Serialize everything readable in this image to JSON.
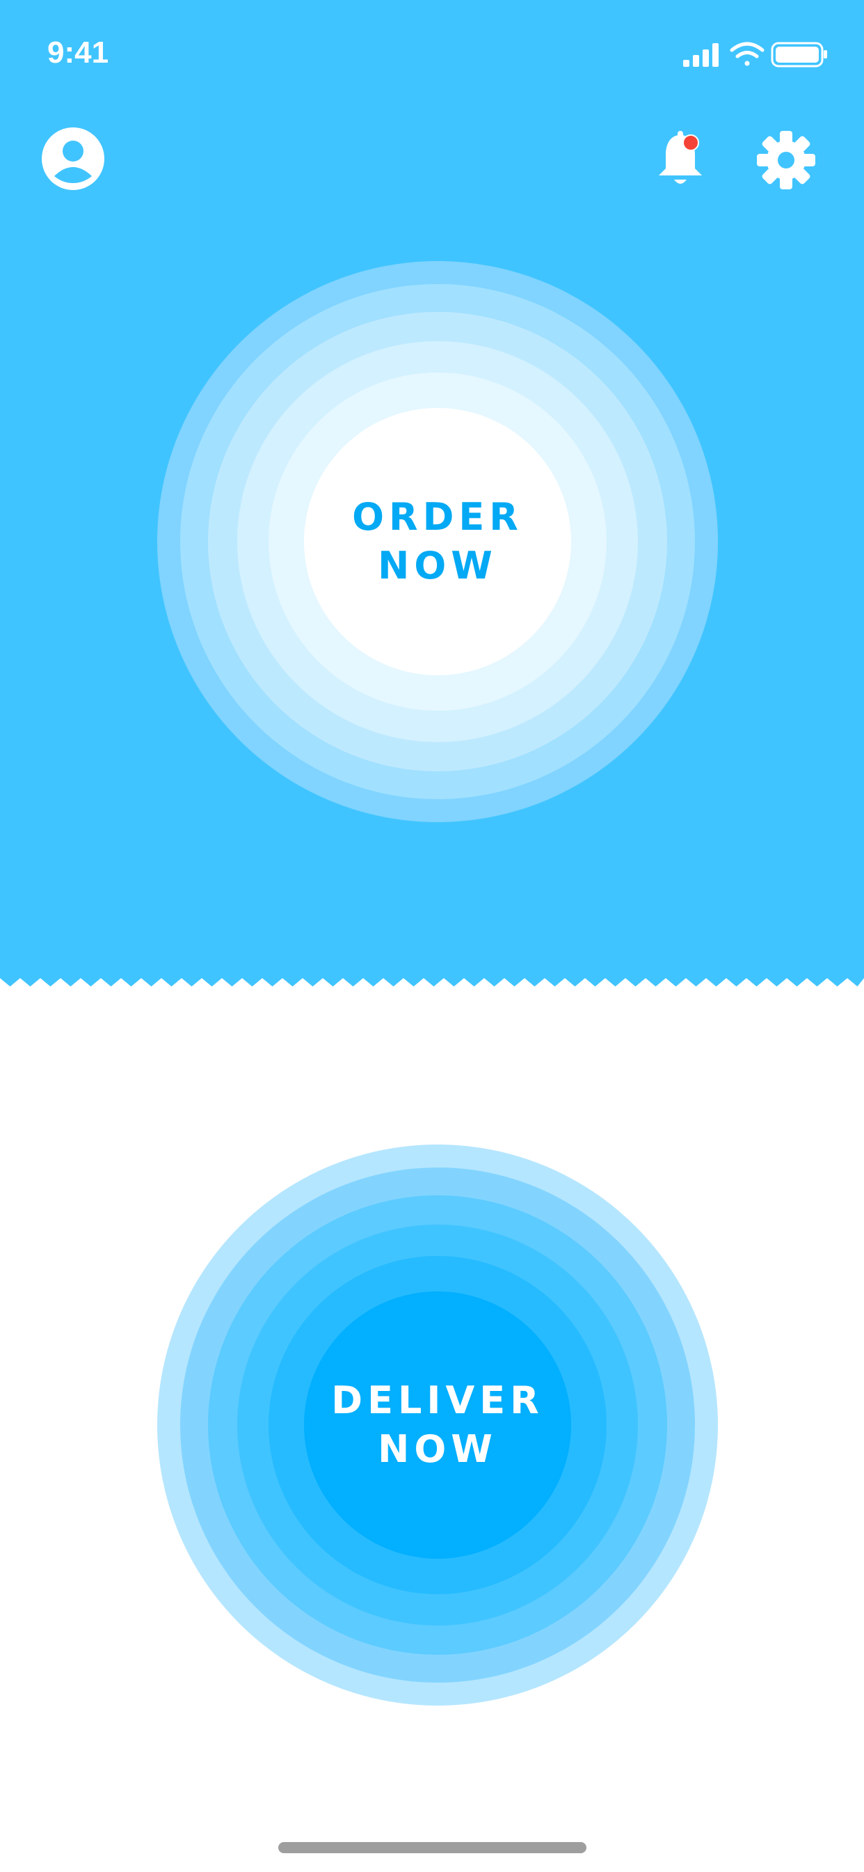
{
  "status_bar": {
    "time": "9:41",
    "icons": [
      "signal-icon",
      "wifi-icon",
      "battery-icon"
    ]
  },
  "header": {
    "profile_icon": "profile-icon",
    "notification_icon": "bell-icon",
    "notification_dot_color": "#f44336",
    "settings_icon": "gear-icon"
  },
  "order_button": {
    "label": "ORDER\nNOW",
    "text_color": "#03a9f4",
    "ring_colors": [
      "#80d4ff",
      "#a1e0ff",
      "#bde9ff",
      "#d3f1ff",
      "#e5f7ff",
      "#ffffff"
    ]
  },
  "deliver_button": {
    "label": "DELIVER\nNOW",
    "text_color": "#ffffff",
    "ring_colors": [
      "#b5e6ff",
      "#82d4ff",
      "#5ccbff",
      "#40c4ff",
      "#26bbff",
      "#03afff"
    ]
  },
  "colors": {
    "top_background": "#40c4ff",
    "bottom_background": "#ffffff",
    "home_indicator": "#9e9e9e"
  }
}
